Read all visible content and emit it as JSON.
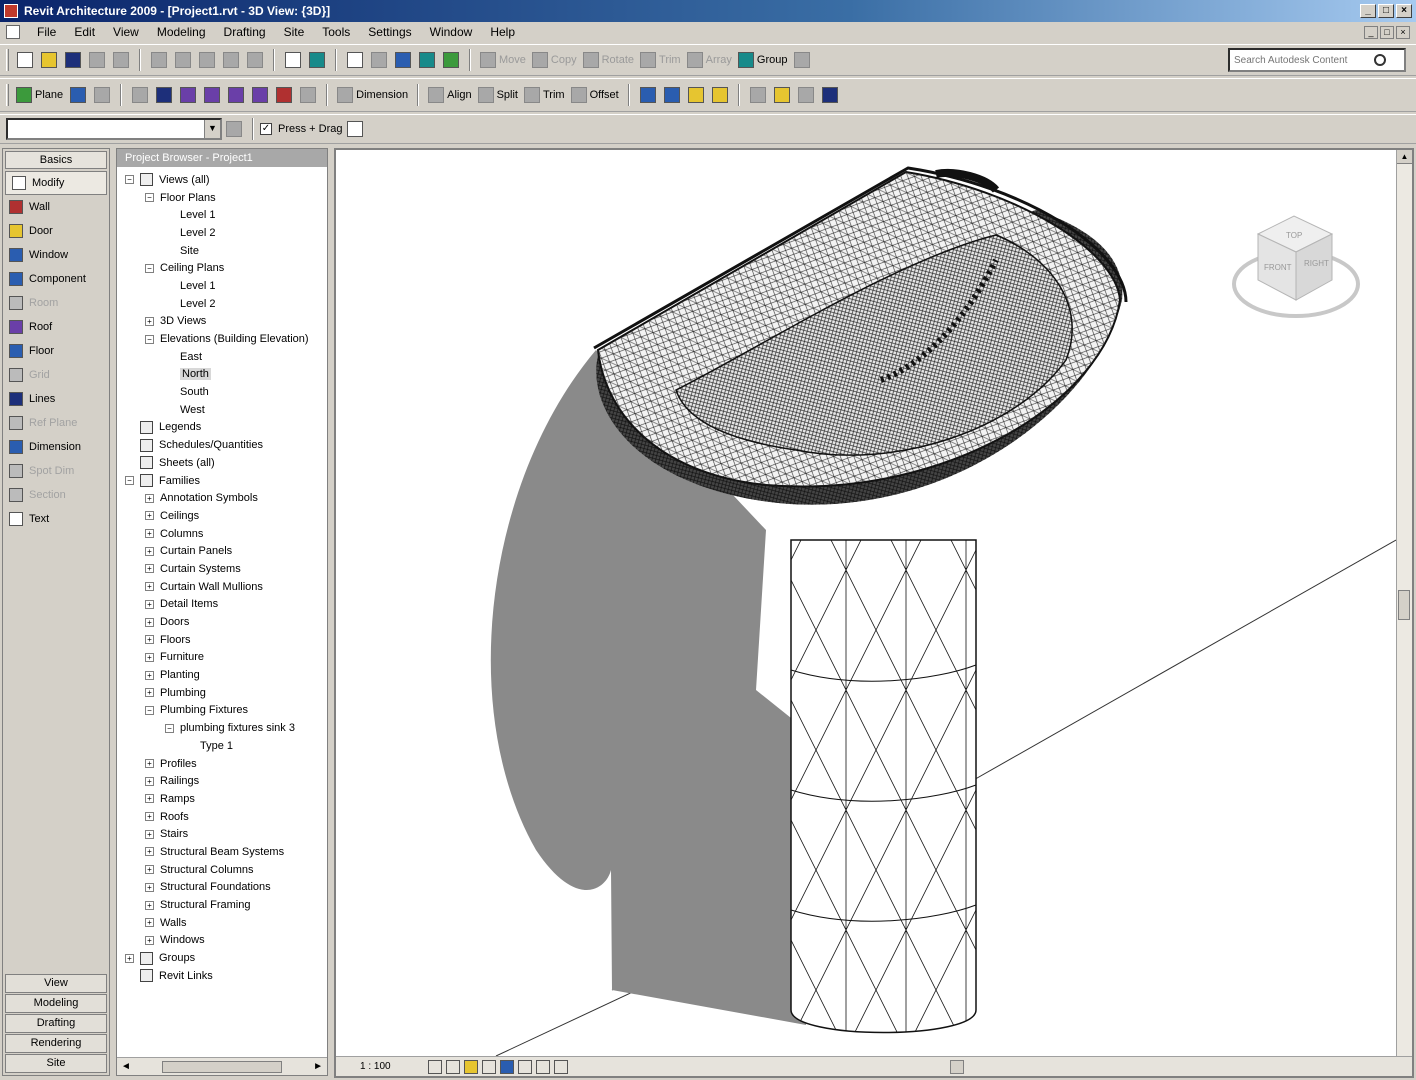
{
  "window": {
    "title": "Revit Architecture 2009 - [Project1.rvt - 3D View: {3D}]",
    "controls": [
      "_",
      "□",
      "×"
    ]
  },
  "menu": [
    "File",
    "Edit",
    "View",
    "Modeling",
    "Drafting",
    "Site",
    "Tools",
    "Settings",
    "Window",
    "Help"
  ],
  "doc_controls": [
    "_",
    "□",
    "×"
  ],
  "toolbar1": {
    "disabled_tools": [
      "Move",
      "Copy",
      "Rotate",
      "Trim",
      "Array"
    ],
    "group_label": "Group",
    "search_placeholder": "Search Autodesk Content"
  },
  "toolbar2": {
    "plane_label": "Plane",
    "dimension_label": "Dimension",
    "align_label": "Align",
    "split_label": "Split",
    "trim_label": "Trim",
    "offset_label": "Offset"
  },
  "toolbar3": {
    "type_selector_value": "",
    "press_drag_label": "Press + Drag",
    "press_drag_checked": true
  },
  "design_bar": {
    "header": "Basics",
    "items": [
      {
        "label": "Modify",
        "icon": "arrow-icon",
        "state": "active"
      },
      {
        "label": "Wall",
        "icon": "wall-icon",
        "state": "normal"
      },
      {
        "label": "Door",
        "icon": "door-icon",
        "state": "normal"
      },
      {
        "label": "Window",
        "icon": "window-icon",
        "state": "normal"
      },
      {
        "label": "Component",
        "icon": "component-icon",
        "state": "normal"
      },
      {
        "label": "Room",
        "icon": "room-icon",
        "state": "disabled"
      },
      {
        "label": "Roof",
        "icon": "roof-icon",
        "state": "normal"
      },
      {
        "label": "Floor",
        "icon": "floor-icon",
        "state": "normal"
      },
      {
        "label": "Grid",
        "icon": "grid-icon",
        "state": "disabled"
      },
      {
        "label": "Lines",
        "icon": "lines-icon",
        "state": "normal"
      },
      {
        "label": "Ref Plane",
        "icon": "ref-plane-icon",
        "state": "disabled"
      },
      {
        "label": "Dimension",
        "icon": "dimension-icon",
        "state": "normal"
      },
      {
        "label": "Spot Dim",
        "icon": "spot-dim-icon",
        "state": "disabled"
      },
      {
        "label": "Section",
        "icon": "section-icon",
        "state": "disabled"
      },
      {
        "label": "Text",
        "icon": "text-icon",
        "state": "normal"
      }
    ],
    "tabs": [
      "View",
      "Modeling",
      "Drafting",
      "Rendering",
      "Site"
    ]
  },
  "project_browser": {
    "title": "Project Browser - Project1",
    "tree": [
      {
        "label": "Views (all)",
        "depth": 0,
        "toggle": "-",
        "icon": true
      },
      {
        "label": "Floor Plans",
        "depth": 1,
        "toggle": "-"
      },
      {
        "label": "Level 1",
        "depth": 2,
        "toggle": ""
      },
      {
        "label": "Level 2",
        "depth": 2,
        "toggle": ""
      },
      {
        "label": "Site",
        "depth": 2,
        "toggle": ""
      },
      {
        "label": "Ceiling Plans",
        "depth": 1,
        "toggle": "-"
      },
      {
        "label": "Level 1",
        "depth": 2,
        "toggle": ""
      },
      {
        "label": "Level 2",
        "depth": 2,
        "toggle": ""
      },
      {
        "label": "3D Views",
        "depth": 1,
        "toggle": "+"
      },
      {
        "label": "Elevations (Building Elevation)",
        "depth": 1,
        "toggle": "-"
      },
      {
        "label": "East",
        "depth": 2,
        "toggle": ""
      },
      {
        "label": "North",
        "depth": 2,
        "toggle": "",
        "selected": true
      },
      {
        "label": "South",
        "depth": 2,
        "toggle": ""
      },
      {
        "label": "West",
        "depth": 2,
        "toggle": ""
      },
      {
        "label": "Legends",
        "depth": 0,
        "toggle": "",
        "icon": true
      },
      {
        "label": "Schedules/Quantities",
        "depth": 0,
        "toggle": "",
        "icon": true
      },
      {
        "label": "Sheets (all)",
        "depth": 0,
        "toggle": "",
        "icon": true
      },
      {
        "label": "Families",
        "depth": 0,
        "toggle": "-",
        "icon": true
      },
      {
        "label": "Annotation Symbols",
        "depth": 1,
        "toggle": "+"
      },
      {
        "label": "Ceilings",
        "depth": 1,
        "toggle": "+"
      },
      {
        "label": "Columns",
        "depth": 1,
        "toggle": "+"
      },
      {
        "label": "Curtain Panels",
        "depth": 1,
        "toggle": "+"
      },
      {
        "label": "Curtain Systems",
        "depth": 1,
        "toggle": "+"
      },
      {
        "label": "Curtain Wall Mullions",
        "depth": 1,
        "toggle": "+"
      },
      {
        "label": "Detail Items",
        "depth": 1,
        "toggle": "+"
      },
      {
        "label": "Doors",
        "depth": 1,
        "toggle": "+"
      },
      {
        "label": "Floors",
        "depth": 1,
        "toggle": "+"
      },
      {
        "label": "Furniture",
        "depth": 1,
        "toggle": "+"
      },
      {
        "label": "Planting",
        "depth": 1,
        "toggle": "+"
      },
      {
        "label": "Plumbing",
        "depth": 1,
        "toggle": "+"
      },
      {
        "label": "Plumbing Fixtures",
        "depth": 1,
        "toggle": "-"
      },
      {
        "label": "plumbing fixtures sink 3",
        "depth": 2,
        "toggle": "-"
      },
      {
        "label": "Type 1",
        "depth": 3,
        "toggle": ""
      },
      {
        "label": "Profiles",
        "depth": 1,
        "toggle": "+"
      },
      {
        "label": "Railings",
        "depth": 1,
        "toggle": "+"
      },
      {
        "label": "Ramps",
        "depth": 1,
        "toggle": "+"
      },
      {
        "label": "Roofs",
        "depth": 1,
        "toggle": "+"
      },
      {
        "label": "Stairs",
        "depth": 1,
        "toggle": "+"
      },
      {
        "label": "Structural Beam Systems",
        "depth": 1,
        "toggle": "+"
      },
      {
        "label": "Structural Columns",
        "depth": 1,
        "toggle": "+"
      },
      {
        "label": "Structural Foundations",
        "depth": 1,
        "toggle": "+"
      },
      {
        "label": "Structural Framing",
        "depth": 1,
        "toggle": "+"
      },
      {
        "label": "Walls",
        "depth": 1,
        "toggle": "+"
      },
      {
        "label": "Windows",
        "depth": 1,
        "toggle": "+"
      },
      {
        "label": "Groups",
        "depth": 0,
        "toggle": "+",
        "icon": true
      },
      {
        "label": "Revit Links",
        "depth": 0,
        "toggle": "",
        "icon": true
      }
    ]
  },
  "view_control": {
    "scale": "1 : 100",
    "icons": [
      "detail-level-icon",
      "visual-style-icon",
      "sun-path-icon",
      "shadows-icon",
      "crop-view-icon",
      "show-crop-icon",
      "hide-isolate-icon",
      "reveal-icon"
    ]
  },
  "viewcube": {
    "faces": [
      "TOP",
      "FRONT",
      "RIGHT"
    ]
  },
  "colors": {
    "titlebar_start": "#0a246a",
    "titlebar_end": "#a6caf0",
    "chrome": "#d4d0c8",
    "shadow": "#8a8a8a"
  }
}
